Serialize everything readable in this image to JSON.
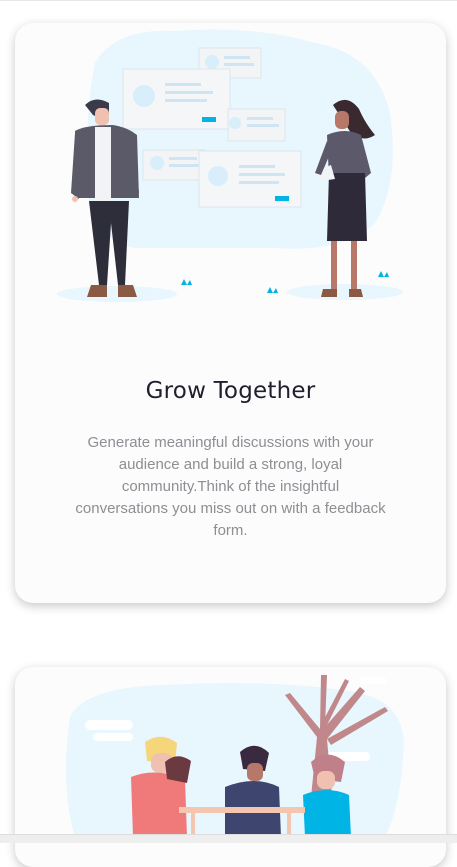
{
  "card1": {
    "title": "Grow Together",
    "description": "Generate meaningful discussions with your audience and build a strong, loyal community.Think of the insightful conversations you miss out on with a feedback form.",
    "illustration": "people-discussing-illustration"
  },
  "card2": {
    "illustration": "team-meeting-under-tree-illustration"
  },
  "colors": {
    "accent": "#00b4e6",
    "blob": "#e8f6fd",
    "title": "#1f1f2e",
    "body_text": "#8e8e93"
  }
}
